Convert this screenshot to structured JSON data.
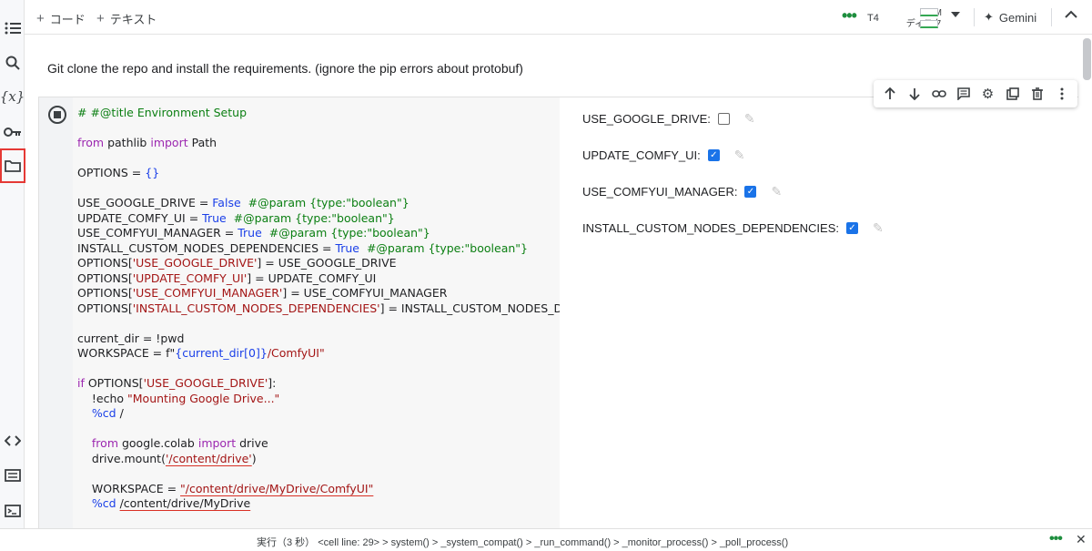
{
  "toolbar": {
    "add_code": "コード",
    "add_text": "テキスト",
    "runtime_type": "T4",
    "ram_label": "RAM",
    "disk_label": "ディスク",
    "gemini_label": "Gemini"
  },
  "sidebar": {
    "items": [
      "table-of-contents",
      "search",
      "variables",
      "secrets",
      "files",
      "code-snippets",
      "command-palette",
      "terminal"
    ],
    "variables_glyph": "{x}"
  },
  "text_cell": {
    "content": "Git clone the repo and install the requirements. (ignore the pip errors about protobuf)"
  },
  "code_cell": {
    "lines": [
      [
        {
          "t": "# #@title Environment Setup",
          "c": "com"
        }
      ],
      [],
      [
        {
          "t": "from",
          "c": "kw"
        },
        {
          "t": " pathlib "
        },
        {
          "t": "import",
          "c": "kw"
        },
        {
          "t": " Path"
        }
      ],
      [],
      [
        {
          "t": "OPTIONS = "
        },
        {
          "t": "{}",
          "c": "const"
        }
      ],
      [],
      [
        {
          "t": "USE_GOOGLE_DRIVE = "
        },
        {
          "t": "False",
          "c": "const"
        },
        {
          "t": "  "
        },
        {
          "t": "#@param {type:\"boolean\"}",
          "c": "com"
        }
      ],
      [
        {
          "t": "UPDATE_COMFY_UI = "
        },
        {
          "t": "True",
          "c": "const"
        },
        {
          "t": "  "
        },
        {
          "t": "#@param {type:\"boolean\"}",
          "c": "com"
        }
      ],
      [
        {
          "t": "USE_COMFYUI_MANAGER = "
        },
        {
          "t": "True",
          "c": "const"
        },
        {
          "t": "  "
        },
        {
          "t": "#@param {type:\"boolean\"}",
          "c": "com"
        }
      ],
      [
        {
          "t": "INSTALL_CUSTOM_NODES_DEPENDENCIES = "
        },
        {
          "t": "True",
          "c": "const"
        },
        {
          "t": "  "
        },
        {
          "t": "#@param {type:\"boolean\"}",
          "c": "com"
        }
      ],
      [
        {
          "t": "OPTIONS["
        },
        {
          "t": "'USE_GOOGLE_DRIVE'",
          "c": "str"
        },
        {
          "t": "] = USE_GOOGLE_DRIVE"
        }
      ],
      [
        {
          "t": "OPTIONS["
        },
        {
          "t": "'UPDATE_COMFY_UI'",
          "c": "str"
        },
        {
          "t": "] = UPDATE_COMFY_UI"
        }
      ],
      [
        {
          "t": "OPTIONS["
        },
        {
          "t": "'USE_COMFYUI_MANAGER'",
          "c": "str"
        },
        {
          "t": "] = USE_COMFYUI_MANAGER"
        }
      ],
      [
        {
          "t": "OPTIONS["
        },
        {
          "t": "'INSTALL_CUSTOM_NODES_DEPENDENCIES'",
          "c": "str"
        },
        {
          "t": "] = INSTALL_CUSTOM_NODES_DEI"
        }
      ],
      [],
      [
        {
          "t": "current_dir = !pwd"
        }
      ],
      [
        {
          "t": "WORKSPACE = f\""
        },
        {
          "t": "{current_dir[0]}",
          "c": "const"
        },
        {
          "t": "/ComfyUI\"",
          "c": "str"
        }
      ],
      [],
      [
        {
          "t": "if",
          "c": "kw"
        },
        {
          "t": " OPTIONS["
        },
        {
          "t": "'USE_GOOGLE_DRIVE'",
          "c": "str"
        },
        {
          "t": "]:"
        }
      ],
      [
        {
          "t": "    !echo "
        },
        {
          "t": "\"Mounting Google Drive...\"",
          "c": "str"
        }
      ],
      [
        {
          "t": "    "
        },
        {
          "t": "%cd",
          "c": "const"
        },
        {
          "t": " /"
        }
      ],
      [],
      [
        {
          "t": "    "
        },
        {
          "t": "from",
          "c": "kw"
        },
        {
          "t": " google.colab "
        },
        {
          "t": "import",
          "c": "kw"
        },
        {
          "t": " drive"
        }
      ],
      [
        {
          "t": "    drive.mount("
        },
        {
          "t": "'/content/drive'",
          "c": "str sq"
        },
        {
          "t": ")"
        }
      ],
      [],
      [
        {
          "t": "    WORKSPACE = "
        },
        {
          "t": "\"/content/drive/MyDrive/ComfyUI\"",
          "c": "str sq"
        }
      ],
      [
        {
          "t": "    "
        },
        {
          "t": "%cd",
          "c": "const"
        },
        {
          "t": " "
        },
        {
          "t": "/content/drive/MyDrive",
          "c": "sq"
        }
      ]
    ]
  },
  "form": {
    "fields": [
      {
        "label": "USE_GOOGLE_DRIVE:",
        "checked": false
      },
      {
        "label": "UPDATE_COMFY_UI:",
        "checked": true
      },
      {
        "label": "USE_COMFYUI_MANAGER:",
        "checked": true
      },
      {
        "label": "INSTALL_CUSTOM_NODES_DEPENDENCIES:",
        "checked": true
      }
    ]
  },
  "cell_toolbar": {
    "buttons": [
      "move-up",
      "move-down",
      "copy-link",
      "comment",
      "settings",
      "open-in-tab",
      "delete",
      "more"
    ]
  },
  "status": {
    "text": "実行（3 秒）   <cell line: 29> > system() > _system_compat() > _run_command() > _monitor_process() > _poll_process()"
  },
  "colors": {
    "comment": "#0b7f12",
    "keyword": "#9c27b0",
    "constant": "#1a3fe8",
    "string": "#a31515",
    "checkbox_on": "#1a73e8",
    "active_highlight": "#e53935",
    "busy_dots": "#1e8e3e"
  }
}
